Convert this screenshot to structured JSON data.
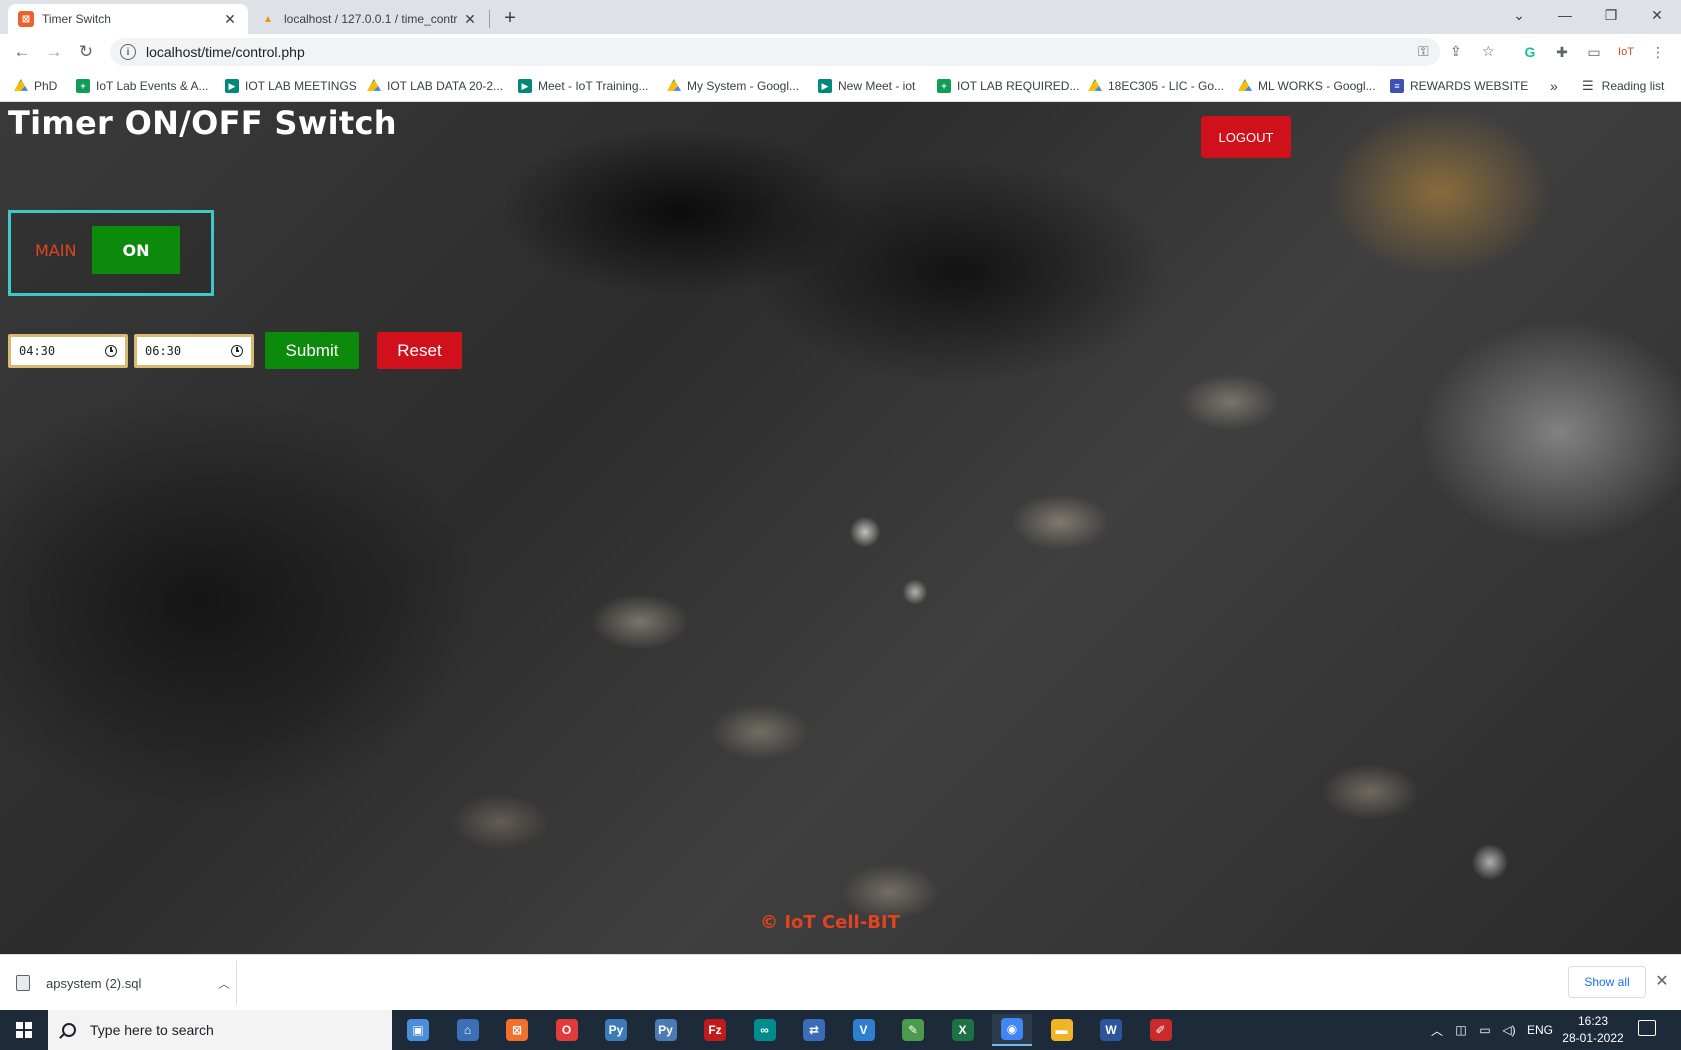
{
  "browser": {
    "tabs": [
      {
        "title": "Timer Switch",
        "favicon_color": "#e8642c",
        "favicon_glyph": "⊠",
        "active": true
      },
      {
        "title": "localhost / 127.0.0.1 / time_contr",
        "favicon_color": "#f29111",
        "favicon_glyph": "▲",
        "active": false
      }
    ],
    "new_tab_glyph": "+",
    "url": "localhost/time/control.php",
    "bookmarks": [
      {
        "label": "PhD",
        "icon": "drive-icon"
      },
      {
        "label": "IoT Lab Events & A...",
        "icon": "sheets-icon"
      },
      {
        "label": "IOT LAB MEETINGS",
        "icon": "meet-icon"
      },
      {
        "label": "IOT LAB DATA 20-2...",
        "icon": "drive-icon"
      },
      {
        "label": "Meet - IoT Training...",
        "icon": "meet-icon"
      },
      {
        "label": "My System - Googl...",
        "icon": "drive-icon"
      },
      {
        "label": "New Meet - iot",
        "icon": "meet-icon"
      },
      {
        "label": "IOT LAB REQUIRED...",
        "icon": "sheets-icon"
      },
      {
        "label": "18EC305 - LIC - Go...",
        "icon": "drive-icon"
      },
      {
        "label": "ML WORKS - Googl...",
        "icon": "drive-icon"
      },
      {
        "label": "REWARDS WEBSITE",
        "icon": "forms-icon"
      }
    ],
    "bookmarks_overflow": "»",
    "reading_list": "Reading list",
    "extension_badge": "IoT"
  },
  "page": {
    "title": "Timer ON/OFF Switch",
    "logout_label": "LOGOUT",
    "switch": {
      "label": "MAIN",
      "state": "ON"
    },
    "start_time": "04:30",
    "end_time": "06:30",
    "submit_label": "Submit",
    "reset_label": "Reset",
    "footer": "© IoT Cell-BIT",
    "colors": {
      "accent_green": "#0c8a0c",
      "accent_red": "#d0101a",
      "label_orange": "#e0431e",
      "box_border": "#3fc8c8"
    }
  },
  "downloads": {
    "file_name": "apsystem (2).sql",
    "show_all": "Show all"
  },
  "taskbar": {
    "search_placeholder": "Type here to search",
    "language": "ENG",
    "time": "16:23",
    "date": "28-01-2022",
    "apps": [
      {
        "name": "task-view-icon",
        "glyph": "▣",
        "color": "#4a90d9"
      },
      {
        "name": "network-pc-icon",
        "glyph": "⌂",
        "color": "#3b6fb6"
      },
      {
        "name": "xampp-icon",
        "glyph": "⊠",
        "color": "#f0712c"
      },
      {
        "name": "opera-icon",
        "glyph": "O",
        "color": "#e23b3b"
      },
      {
        "name": "python-icon",
        "glyph": "Py",
        "color": "#3d7ab8"
      },
      {
        "name": "python-idle-icon",
        "glyph": "Py",
        "color": "#4b7bb0"
      },
      {
        "name": "filezilla-icon",
        "glyph": "Fz",
        "color": "#c01b1b"
      },
      {
        "name": "arduino-icon",
        "glyph": "∞",
        "color": "#008c8c"
      },
      {
        "name": "network-tool-icon",
        "glyph": "⇄",
        "color": "#3c6bb8"
      },
      {
        "name": "vs-icon",
        "glyph": "V",
        "color": "#2e7fd0"
      },
      {
        "name": "notepad-icon",
        "glyph": "✎",
        "color": "#4c9a4c"
      },
      {
        "name": "excel-icon",
        "glyph": "X",
        "color": "#1e7145"
      },
      {
        "name": "chrome-icon",
        "glyph": "◉",
        "color": "#4285f4"
      },
      {
        "name": "file-explorer-icon",
        "glyph": "▬",
        "color": "#f0b429"
      },
      {
        "name": "word-icon",
        "glyph": "W",
        "color": "#2b579a"
      },
      {
        "name": "paint-icon",
        "glyph": "✐",
        "color": "#c92a2a"
      }
    ]
  }
}
